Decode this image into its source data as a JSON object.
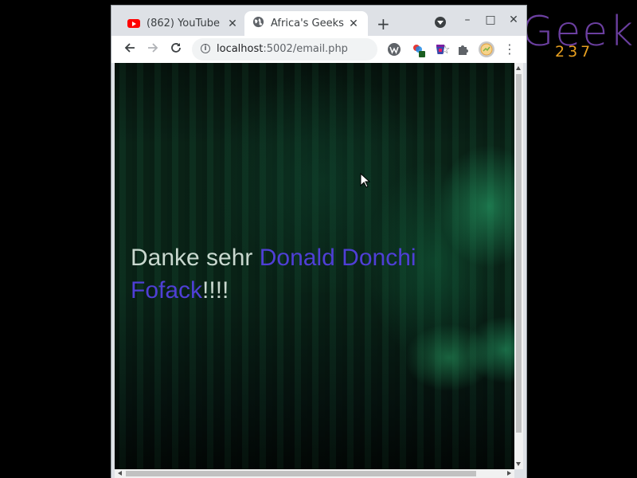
{
  "logo": {
    "word": "Geek",
    "number": "237"
  },
  "browser": {
    "tabs": [
      {
        "title": "(862) YouTube",
        "icon": "youtube-icon",
        "active": false
      },
      {
        "title": "Africa's Geeks",
        "icon": "globe-icon",
        "active": true
      }
    ],
    "window_controls": {
      "minimize": "–",
      "maximize": "□",
      "close": "✕"
    },
    "address": {
      "host": "localhost",
      "path": ":5002/email.php"
    }
  },
  "page": {
    "greeting": "Danke sehr ",
    "name": "Donald Donchi Fofack",
    "suffix": "!!!!",
    "colors": {
      "greeting": "#c9d8cf",
      "name": "#4f3fd6"
    }
  }
}
